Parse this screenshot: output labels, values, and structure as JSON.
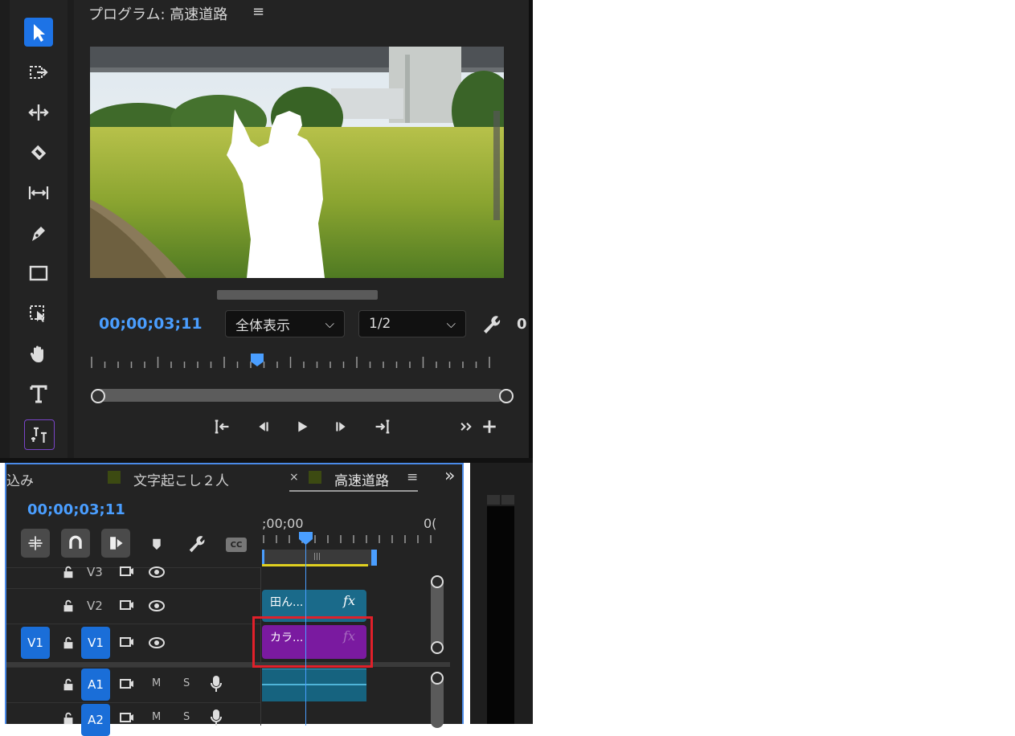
{
  "program_monitor": {
    "title": "プログラム: 高速道路",
    "menu_icon": "≡",
    "timecode": "00;00;03;11",
    "zoom_select": "全体表示",
    "resolution_select": "1/2",
    "extra_value": "0"
  },
  "tools": [
    {
      "name": "selection-tool-icon"
    },
    {
      "name": "track-select-forward-tool-icon"
    },
    {
      "name": "ripple-edit-tool-icon"
    },
    {
      "name": "razor-tool-icon"
    },
    {
      "name": "slip-tool-icon"
    },
    {
      "name": "pen-tool-icon"
    },
    {
      "name": "rectangle-tool-icon"
    },
    {
      "name": "remix-tool-icon"
    },
    {
      "name": "hand-tool-icon"
    },
    {
      "name": "type-tool-icon"
    },
    {
      "name": "caption-tool-icon"
    }
  ],
  "timeline": {
    "tab_partial": "込み",
    "tab_1": "文字起こし２人",
    "tab_close": "×",
    "tab_active": "高速道路",
    "tab_menu": "≡",
    "overflow": "»",
    "timecode": "00;00;03;11",
    "ruler_start": ";00;00",
    "ruler_end": "0(",
    "cc_label": "CC",
    "tracks": {
      "v3": "V3",
      "v2": "V2",
      "v1_source": "V1",
      "v1": "V1",
      "a1": "A1",
      "a2": "A2",
      "m": "M",
      "s": "S"
    },
    "clips": {
      "v2_clip": "田ん...",
      "v1_clip": "カラ...",
      "fx": "fx"
    }
  },
  "colors": {
    "accent_blue": "#4a9eff",
    "highlight_red": "#e0202a",
    "clip_teal": "#1a6a8a",
    "clip_purple": "#7a1aa0"
  }
}
